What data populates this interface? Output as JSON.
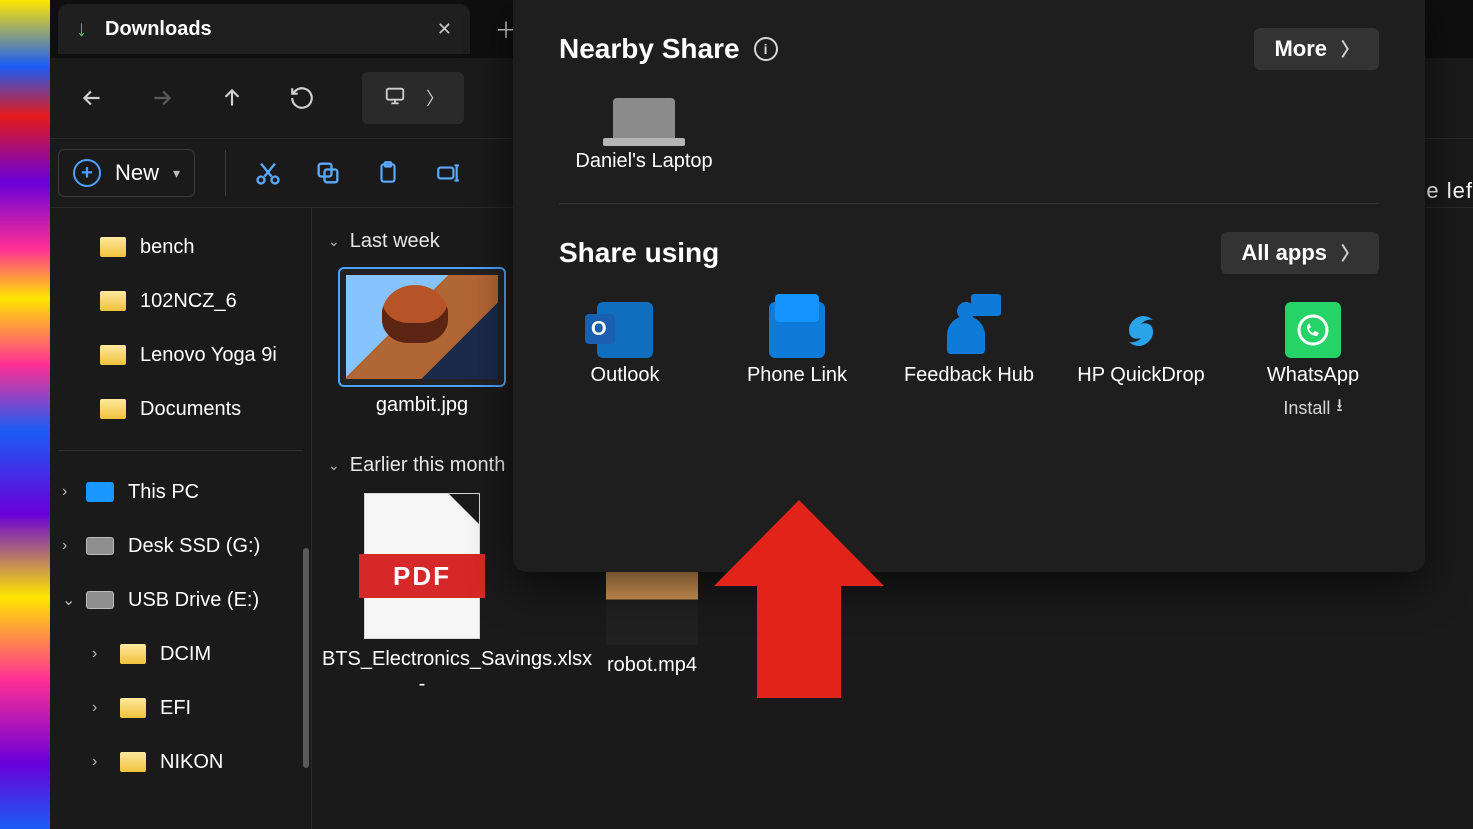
{
  "tab": {
    "title": "Downloads"
  },
  "toolbar": {
    "new_label": "New"
  },
  "sidebar": {
    "top_folders": [
      "bench",
      "102NCZ_6",
      "Lenovo Yoga 9i",
      "Documents"
    ],
    "drives": [
      {
        "label": "This PC",
        "kind": "pc",
        "expanded": false
      },
      {
        "label": "Desk SSD (G:)",
        "kind": "drive",
        "expanded": false
      },
      {
        "label": "USB Drive (E:)",
        "kind": "drive",
        "expanded": true,
        "children": [
          "DCIM",
          "EFI",
          "NIKON"
        ]
      }
    ]
  },
  "content": {
    "groups": [
      {
        "header": "Last week",
        "items": [
          {
            "label": "gambit.jpg",
            "kind": "image1",
            "selected": true
          }
        ]
      },
      {
        "header": "Earlier this month",
        "items": [
          {
            "label": "BTS_Electronics_Savings.xlsx -",
            "kind": "pdf"
          },
          {
            "label": "robot.mp4",
            "kind": "image2"
          }
        ]
      }
    ]
  },
  "share": {
    "nearby_title": "Nearby Share",
    "more_label": "More",
    "device_name": "Daniel's Laptop",
    "share_using_title": "Share using",
    "all_apps_label": "All apps",
    "apps": [
      {
        "label": "Outlook",
        "icon": "outlook"
      },
      {
        "label": "Phone Link",
        "icon": "phone"
      },
      {
        "label": "Feedback Hub",
        "icon": "feedback"
      },
      {
        "label": "HP QuickDrop",
        "icon": "hp"
      },
      {
        "label": "WhatsApp",
        "icon": "whatsapp",
        "sub": "Install"
      }
    ]
  },
  "pdf_band": "PDF",
  "edge_text": "e lef"
}
